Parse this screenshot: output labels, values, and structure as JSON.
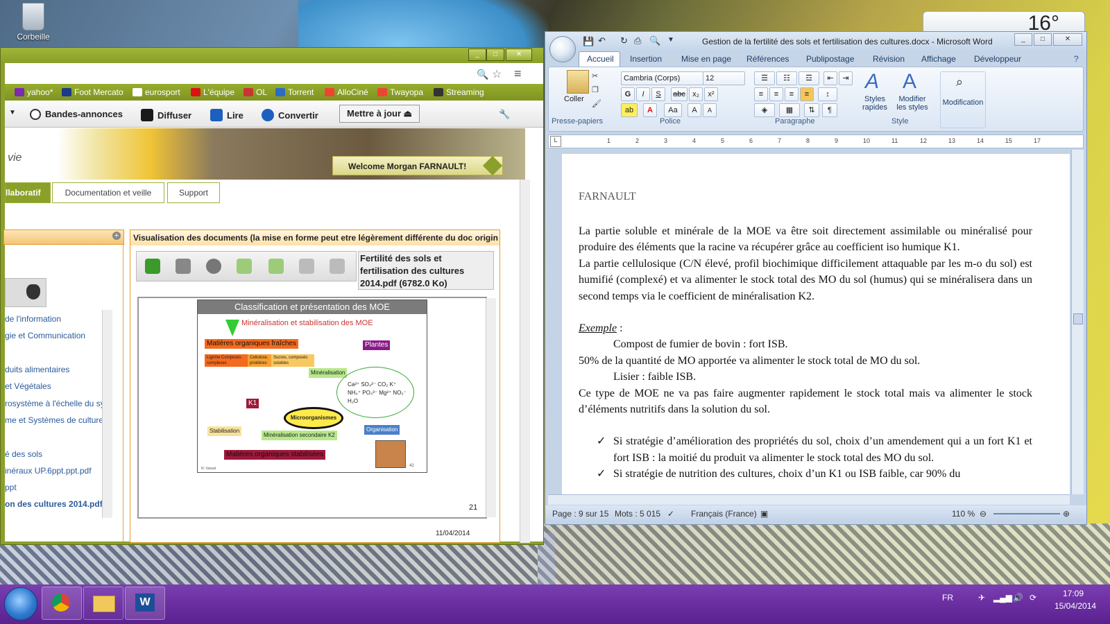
{
  "desktop": {
    "recycle_bin_label": "Corbeille",
    "weather_temp": "16°"
  },
  "browser": {
    "bookmarks": [
      "yahoo*",
      "Foot Mercato",
      "eurosport",
      "L'équipe",
      "OL",
      "Torrent",
      "AlloCiné",
      "Twayopa",
      "Streaming"
    ],
    "toolbar": [
      "Bandes-annonces",
      "Diffuser",
      "Lire",
      "Convertir",
      "Mettre à jour"
    ],
    "welcome": "Welcome Morgan FARNAULT!",
    "banner_text": "vie",
    "nav_tabs": [
      "llaboratif",
      "Documentation et veille",
      "Support"
    ],
    "left_list": [
      "de l'information",
      "gie et Communication",
      "duits alimentaires",
      "et Végétales",
      "rosystème à l'échelle du sy",
      "me et Systèmes de culture",
      "é des sols",
      "inéraux UP.6ppt.ppt.pdf",
      "ppt",
      "on des cultures 2014.pdf"
    ],
    "doc_panel_title": "Visualisation des documents (la mise en forme peut etre légèrement différente du doc origin",
    "file_name": "Fertilité des sols et fertilisation des cultures 2014.pdf (6782.0 Ko)",
    "page_number": "21",
    "date_partial": "11/04/2014",
    "slide": {
      "title": "Classification et présentation des MOE",
      "subtitle": "Minéralisation et stabilisation des MOE",
      "fresh": "Matières organiques fraîches",
      "plants": "Plantes",
      "lignine": "Lignine Composés complexes",
      "cellulose": "Cellulose, protéines",
      "sucres": "Sucres, composés solubles",
      "mineralisation": "Minéralisation",
      "ions": "Ca²⁺  SO₄²⁻  CO₂  K⁺  NH₄⁺  PO₄³⁻  Mg²⁺  NO₃⁻  H₂O",
      "k1": "K1",
      "micro": "Microorganismes",
      "stabilisation": "Stabilisation",
      "min2": "Minéralisation secondaire K2",
      "organisation": "Organisation",
      "stabilised": "Matières organiques stabilisées",
      "author": "N. Vassal",
      "slide_no": "42"
    }
  },
  "word": {
    "title": "Gestion de la fertilité des sols et fertilisation des cultures.docx - Microsoft Word",
    "tabs": [
      "Accueil",
      "Insertion",
      "Mise en page",
      "Références",
      "Publipostage",
      "Révision",
      "Affichage",
      "Développeur"
    ],
    "ribbon": {
      "paste": "Coller",
      "clipboard_group": "Presse-papiers",
      "font_name": "Cambria (Corps)",
      "font_size": "12",
      "font_group": "Police",
      "paragraph_group": "Paragraphe",
      "styles_quick": "Styles rapides",
      "styles_modify": "Modifier les styles",
      "style_group": "Style",
      "edit": "Modification"
    },
    "ruler_numbers": [
      "1",
      "2",
      "3",
      "4",
      "5",
      "6",
      "7",
      "8",
      "9",
      "10",
      "11",
      "12",
      "13",
      "14",
      "15",
      "17"
    ],
    "doc": {
      "header": "FARNAULT",
      "p1": "La partie soluble et minérale de la MOE va être soit directement assimilable ou minéralisé pour produire des éléments que la racine va récupérer grâce au coefficient iso humique K1.",
      "p2": "La partie cellulosique (C/N élevé, profil biochimique difficilement attaquable par les m-o du sol) est humifié (complexé) et va alimenter le stock total des MO du sol (humus) qui se minéralisera dans un second temps via le coefficient de minéralisation K2.",
      "example_label": "Exemple",
      "example_colon": " :",
      "ex1": "Compost de fumier de bovin : fort ISB.",
      "ex2": "50% de la quantité de MO apportée va alimenter le stock total de MO du sol.",
      "ex3": "Lisier : faible ISB.",
      "p3": "Ce type de MOE ne va pas faire augmenter rapidement le stock total mais va alimenter le stock d’éléments nutritifs dans la solution du sol.",
      "b1": "Si stratégie d’amélioration des propriétés du sol, choix d’un amendement qui a un fort K1 et fort ISB : la moitié du produit va alimenter le stock total des MO du sol.",
      "b2": "Si stratégie de nutrition des cultures, choix d’un K1 ou ISB faible, car 90% du"
    },
    "status": {
      "page": "Page : 9 sur 15",
      "words": "Mots : 5 015",
      "lang": "Français (France)",
      "zoom": "110 %"
    }
  },
  "taskbar": {
    "lang": "FR",
    "time": "17:09",
    "date": "15/04/2014"
  }
}
